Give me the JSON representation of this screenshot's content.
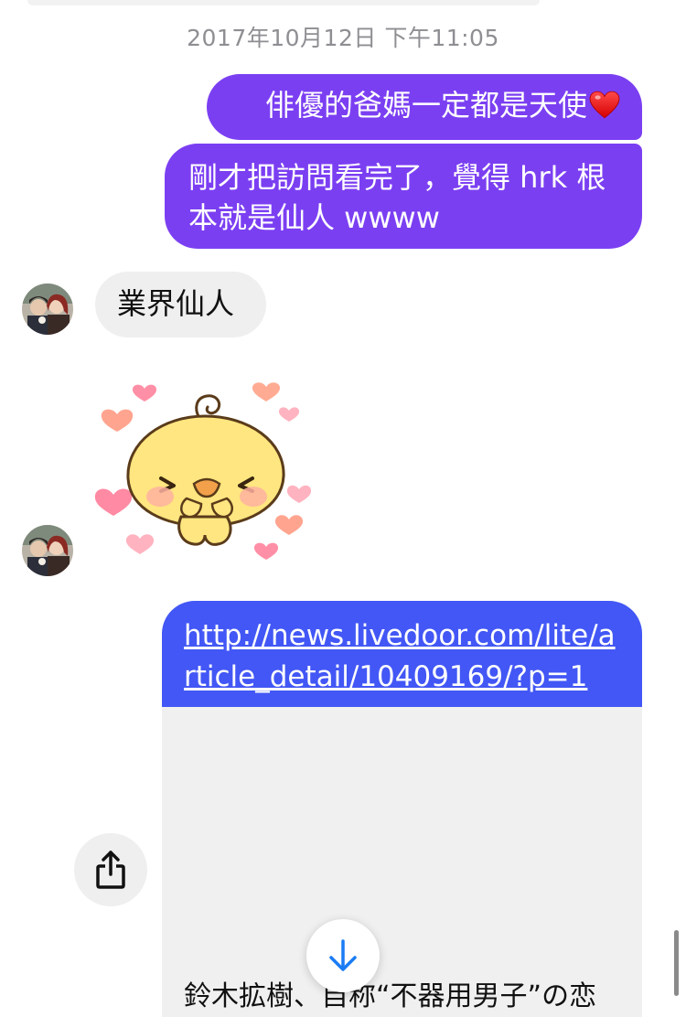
{
  "conversation": {
    "timestamp": "2017年10月12日 下午11:05",
    "messages": [
      {
        "direction": "outgoing",
        "text": "俳優的爸媽一定都是天使",
        "emoji": "red-heart"
      },
      {
        "direction": "outgoing",
        "text": "剛才把訪問看完了，覺得 hrk 根本就是仙人 wwww"
      },
      {
        "direction": "incoming",
        "text": "業界仙人"
      },
      {
        "direction": "incoming",
        "type": "sticker",
        "sticker": "yellow-chick-with-hearts"
      }
    ],
    "link_card": {
      "url": "http://news.livedoor.com/lite/article_detail/10409169/?p=1",
      "preview_title": "鈴木拡樹、自称“不器用男子”の恋"
    }
  },
  "colors": {
    "outgoing_bubble": "#7b3ff2",
    "incoming_bubble": "#efefef",
    "link_header": "#4257f5",
    "timestamp_text": "#8e8e93",
    "scroll_button_arrow": "#1a7cf5"
  },
  "icons": {
    "share": "share-icon",
    "scroll_down": "arrow-down-icon"
  }
}
